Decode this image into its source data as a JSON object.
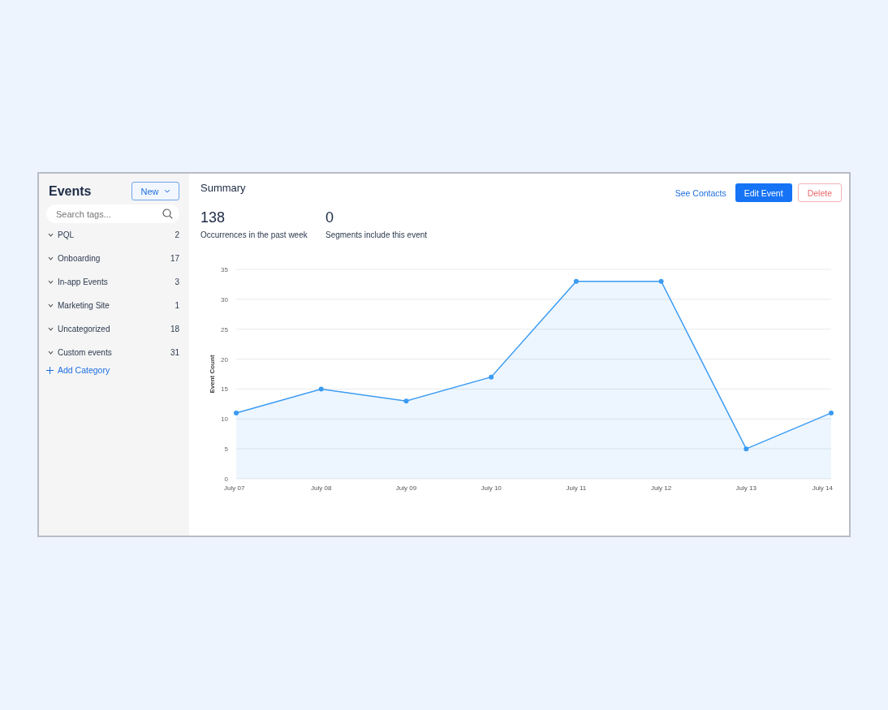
{
  "sidebar": {
    "title": "Events",
    "new_button": {
      "label": "New"
    },
    "search": {
      "placeholder": "Search tags..."
    },
    "categories": [
      {
        "name": "PQL",
        "count": "2",
        "expanded": false
      },
      {
        "name": "Onboarding",
        "count": "17",
        "expanded": false
      },
      {
        "name": "In-app Events",
        "count": "3",
        "expanded": false
      },
      {
        "name": "Marketing Site",
        "count": "1",
        "expanded": false
      },
      {
        "name": "Uncategorized",
        "count": "18",
        "expanded": false
      },
      {
        "name": "Custom events",
        "count": "31",
        "expanded": false
      }
    ],
    "add_category": "Add Category"
  },
  "main": {
    "title": "Summary",
    "see_contacts": "See Contacts",
    "edit_button": "Edit Event",
    "delete_button": "Delete",
    "stats": [
      {
        "value": "138",
        "label": "Occurrences in the past week"
      },
      {
        "value": "0",
        "label": "Segments include this event"
      }
    ],
    "chart_data": {
      "type": "area",
      "ylabel": "Event Count",
      "categories": [
        "July 07",
        "July 08",
        "July 09",
        "July 10",
        "July 11",
        "July 12",
        "July 13",
        "July 14"
      ],
      "series": [
        {
          "color": "#3b9bf2",
          "values": [
            11,
            15,
            13,
            17,
            33,
            33,
            5,
            11
          ]
        }
      ],
      "grid": true,
      "ylim": [
        0,
        35
      ],
      "yticks": [
        0,
        5,
        10,
        15,
        20,
        25,
        30,
        35
      ]
    }
  }
}
